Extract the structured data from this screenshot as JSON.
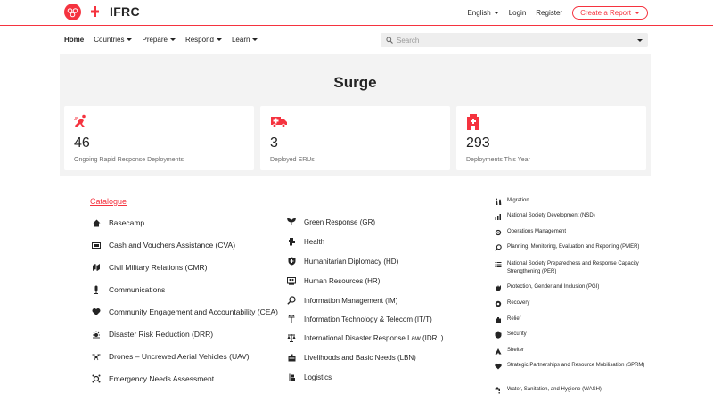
{
  "header": {
    "brand": "IFRC",
    "language": "English",
    "login": "Login",
    "register": "Register",
    "create_report": "Create a Report"
  },
  "nav": {
    "items": [
      {
        "label": "Home",
        "active": true
      },
      {
        "label": "Countries",
        "dropdown": true
      },
      {
        "label": "Prepare",
        "dropdown": true
      },
      {
        "label": "Respond",
        "dropdown": true
      },
      {
        "label": "Learn",
        "dropdown": true
      }
    ],
    "search_placeholder": "Search"
  },
  "hero": {
    "title": "Surge",
    "stats": [
      {
        "value": "46",
        "label": "Ongoing Rapid Response Deployments",
        "icon": "rapid-response-icon"
      },
      {
        "value": "3",
        "label": "Deployed ERUs",
        "icon": "ambulance-icon"
      },
      {
        "value": "293",
        "label": "Deployments This Year",
        "icon": "hospital-icon"
      }
    ]
  },
  "catalogue": {
    "title": "Catalogue",
    "column_a": [
      {
        "label": "Basecamp",
        "icon": "house-icon"
      },
      {
        "label": "Cash and Vouchers Assistance (CVA)",
        "icon": "cash-icon"
      },
      {
        "label": "Civil Military Relations (CMR)",
        "icon": "handshake-icon"
      },
      {
        "label": "Communications",
        "icon": "microphone-icon"
      },
      {
        "label": "Community Engagement and Accountability (CEA)",
        "icon": "heart-hand-icon"
      },
      {
        "label": "Disaster Risk Reduction (DRR)",
        "icon": "sun-warning-icon"
      },
      {
        "label": "Drones – Uncrewed Aerial Vehicles (UAV)",
        "icon": "drone-icon"
      },
      {
        "label": "Emergency Needs Assessment",
        "icon": "assessment-icon"
      }
    ],
    "column_b": [
      {
        "label": "Green Response (GR)",
        "icon": "leaf-icon"
      },
      {
        "label": "Health",
        "icon": "health-icon"
      },
      {
        "label": "Humanitarian Diplomacy (HD)",
        "icon": "shield-icon"
      },
      {
        "label": "Human Resources (HR)",
        "icon": "people-icon"
      },
      {
        "label": "Information Management (IM)",
        "icon": "magnifier-icon"
      },
      {
        "label": "Information Technology & Telecom (IT/T)",
        "icon": "antenna-icon"
      },
      {
        "label": "International Disaster Response Law (IDRL)",
        "icon": "scales-icon"
      },
      {
        "label": "Livelihoods and Basic Needs (LBN)",
        "icon": "box-icon"
      },
      {
        "label": "Logistics",
        "icon": "logistics-icon"
      }
    ],
    "column_c": [
      {
        "label": "Migration",
        "icon": "migration-icon"
      },
      {
        "label": "National Society Development (NSD)",
        "icon": "growth-icon"
      },
      {
        "label": "Operations Management",
        "icon": "operations-icon"
      },
      {
        "label": "Planning, Monitoring, Evaluation and Reporting (PMER)",
        "icon": "magnifier-icon"
      },
      {
        "label": "National Society Preparedness and Response Capacity Strengthening (PER)",
        "icon": "list-icon"
      },
      {
        "label": "Protection, Gender and Inclusion (PGI)",
        "icon": "protection-icon"
      },
      {
        "label": "Recovery",
        "icon": "recovery-icon"
      },
      {
        "label": "Relief",
        "icon": "relief-icon"
      },
      {
        "label": "Security",
        "icon": "security-icon"
      },
      {
        "label": "Shelter",
        "icon": "shelter-icon"
      },
      {
        "label": "Strategic Partnerships and Resource Mobilisation (SPRM)",
        "icon": "partnership-icon"
      },
      {
        "label": "Water, Sanitation, and Hygiene (WASH)",
        "icon": "tap-icon"
      }
    ]
  },
  "colors": {
    "accent": "#f5333f",
    "text": "#242424",
    "muted": "#6b6b6b",
    "hero_bg": "#f3f3f3"
  }
}
